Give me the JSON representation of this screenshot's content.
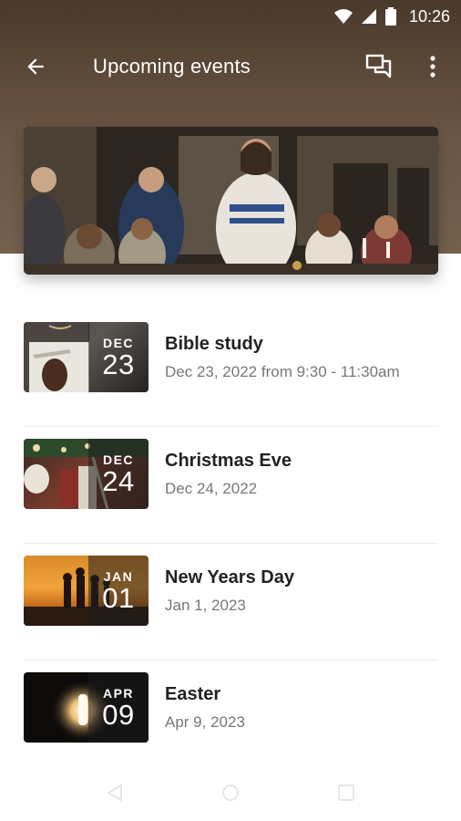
{
  "status_bar": {
    "time": "10:26",
    "icons": [
      "wifi-icon",
      "signal-icon",
      "battery-icon"
    ]
  },
  "app_bar": {
    "title": "Upcoming events",
    "icons": [
      "back-arrow-icon",
      "chat-icon",
      "more-vert-icon"
    ]
  },
  "hero": {
    "image": "last-supper-scene"
  },
  "events": [
    {
      "month": "DEC",
      "day": "23",
      "name": "Bible study",
      "when": "Dec 23, 2022 from 9:30 - 11:30am"
    },
    {
      "month": "DEC",
      "day": "24",
      "name": "Christmas Eve",
      "when": "Dec 24, 2022"
    },
    {
      "month": "JAN",
      "day": "01",
      "name": "New Years Day",
      "when": "Jan 1, 2023"
    },
    {
      "month": "APR",
      "day": "09",
      "name": "Easter",
      "when": "Apr 9, 2023"
    }
  ],
  "nav_bar": {
    "icons": [
      "nav-back-icon",
      "nav-home-icon",
      "nav-recents-icon"
    ]
  },
  "colors": {
    "header": "#5a4735",
    "title_text": "#222222",
    "subtext": "#777777"
  }
}
